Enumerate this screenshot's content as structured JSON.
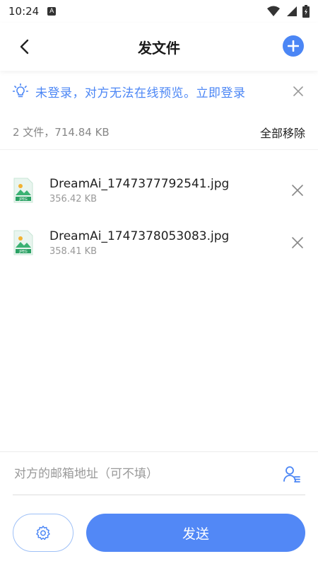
{
  "status_bar": {
    "time": "10:24",
    "badge": "A"
  },
  "header": {
    "title": "发文件"
  },
  "notice": {
    "message": "未登录，对方无法在线预览。立即登录"
  },
  "summary": {
    "count_text": "2 文件，714.84 KB",
    "remove_all_label": "全部移除"
  },
  "files": [
    {
      "name": "DreamAi_1747377792541.jpg",
      "size": "356.42 KB",
      "type_label": "JPEG"
    },
    {
      "name": "DreamAi_1747378053083.jpg",
      "size": "358.41 KB",
      "type_label": "JPEG"
    }
  ],
  "email": {
    "placeholder": "对方的邮箱地址（可不填）",
    "value": ""
  },
  "actions": {
    "send_label": "发送"
  },
  "colors": {
    "accent": "#4b86f5",
    "send_button": "#5288f6"
  }
}
